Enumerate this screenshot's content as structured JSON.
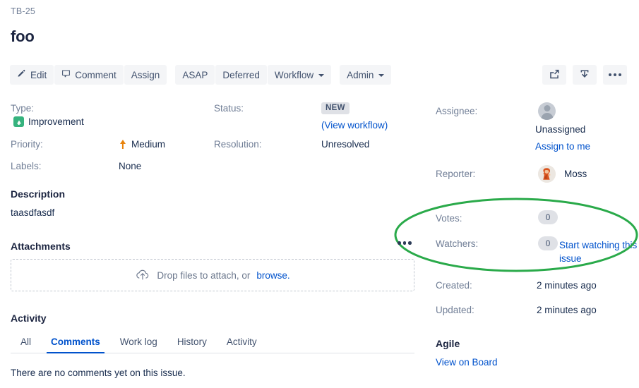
{
  "header": {
    "breadcrumb": "TB-25",
    "title": "foo"
  },
  "toolbar": {
    "edit": "Edit",
    "comment": "Comment",
    "assign": "Assign",
    "asap": "ASAP",
    "deferred": "Deferred",
    "workflow": "Workflow",
    "admin": "Admin",
    "icons": {
      "export": "share-export-icon",
      "import": "import-download-icon",
      "more": "more-actions-icon"
    }
  },
  "details": {
    "type_label": "Type:",
    "type_value": "Improvement",
    "type_icon_color": "#36b37e",
    "priority_label": "Priority:",
    "priority_value": "Medium",
    "priority_icon_color": "#e8830c",
    "labels_label": "Labels:",
    "labels_value": "None",
    "status_label": "Status:",
    "status_value": "NEW",
    "view_workflow": "(View workflow)",
    "resolution_label": "Resolution:",
    "resolution_value": "Unresolved"
  },
  "description": {
    "heading": "Description",
    "body": "taasdfasdf"
  },
  "attachments": {
    "heading": "Attachments",
    "dropzone_text": "Drop files to attach, or ",
    "browse_link": "browse.",
    "icon": "cloud-upload-icon"
  },
  "activity": {
    "heading": "Activity",
    "tabs": [
      {
        "label": "All",
        "active": false
      },
      {
        "label": "Comments",
        "active": true
      },
      {
        "label": "Work log",
        "active": false
      },
      {
        "label": "History",
        "active": false
      },
      {
        "label": "Activity",
        "active": false
      }
    ],
    "empty_text": "There are no comments yet on this issue."
  },
  "people": {
    "assignee_label": "Assignee:",
    "assignee_name": "Unassigned",
    "assign_to_me": "Assign to me",
    "reporter_label": "Reporter:",
    "reporter_name": "Moss"
  },
  "engagement": {
    "votes_label": "Votes:",
    "votes_count": "0",
    "watchers_label": "Watchers:",
    "watchers_count": "0",
    "start_watching": "Start watching this issue"
  },
  "dates": {
    "created_label": "Created:",
    "created_value": "2 minutes ago",
    "updated_label": "Updated:",
    "updated_value": "2 minutes ago"
  },
  "agile": {
    "heading": "Agile",
    "view_on_board": "View on Board"
  },
  "annotation": {
    "shape": "green-ellipse-highlight",
    "color": "#2aaa4a",
    "target": "votes-and-watchers"
  }
}
